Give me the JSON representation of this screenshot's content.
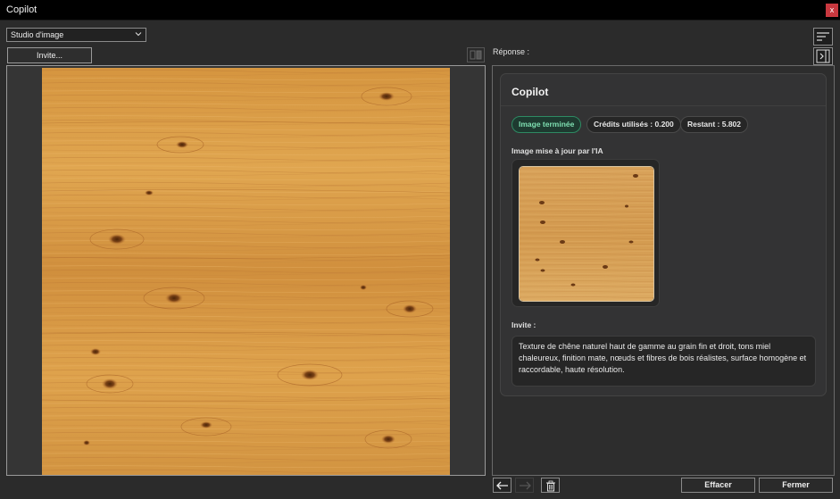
{
  "window": {
    "title": "Copilot",
    "close_label": "x"
  },
  "toolbar": {
    "mode_select_value": "Studio d'image",
    "invite_button": "Invite..."
  },
  "response": {
    "label": "Réponse :",
    "card": {
      "title": "Copilot",
      "badges": {
        "status": "Image terminée",
        "credits": "Crédits utilisés : 0.200",
        "remaining": "Restant : 5.802"
      },
      "image_label": "Image mise à jour par l'IA",
      "prompt_label": "Invite :",
      "prompt_text": "Texture de chêne naturel haut de gamme au grain fin et droit, tons miel chaleureux, finition mate, nœuds et fibres de bois réalistes, surface homogène et raccordable, haute résolution."
    }
  },
  "footer": {
    "clear_button": "Effacer",
    "close_button": "Fermer"
  },
  "colors": {
    "wood_base": "#d99a45",
    "wood_light": "#e8b465",
    "wood_dark": "#a8652a",
    "knot": "#6b3a15",
    "status_green": "#2e8a63",
    "close_red": "#c8383f"
  }
}
